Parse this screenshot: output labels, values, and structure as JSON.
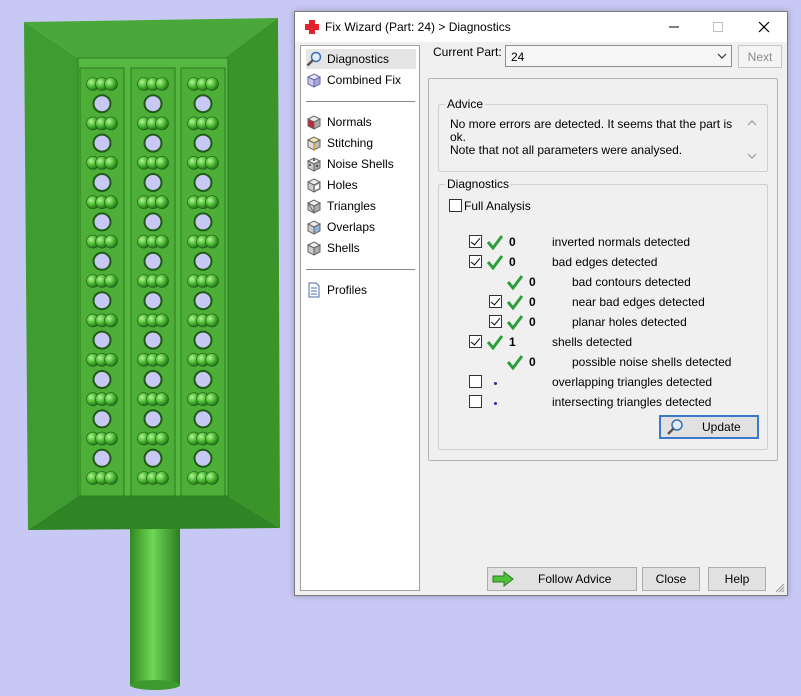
{
  "window": {
    "title": "Fix Wizard (Part: 24) > Diagnostics"
  },
  "nav": {
    "top_items": [
      {
        "label": "Diagnostics",
        "icon": "magnifier-icon",
        "selected": true
      },
      {
        "label": "Combined Fix",
        "icon": "combined-fix-cube-icon",
        "selected": false
      }
    ],
    "tool_items": [
      {
        "label": "Normals",
        "icon": "normals-cube-icon"
      },
      {
        "label": "Stitching",
        "icon": "stitching-cube-icon"
      },
      {
        "label": "Noise Shells",
        "icon": "noise-shells-cube-icon"
      },
      {
        "label": "Holes",
        "icon": "holes-cube-icon"
      },
      {
        "label": "Triangles",
        "icon": "triangles-cube-icon"
      },
      {
        "label": "Overlaps",
        "icon": "overlaps-cube-icon"
      },
      {
        "label": "Shells",
        "icon": "shells-cube-icon"
      }
    ],
    "bottom_items": [
      {
        "label": "Profiles",
        "icon": "document-icon"
      }
    ]
  },
  "part": {
    "label": "Current Part:",
    "value": "24",
    "next_label": "Next"
  },
  "advice": {
    "heading": "Advice",
    "text_line1": "No more errors are detected. It seems that the part is ok.",
    "text_line2": "Note that not all parameters were analysed."
  },
  "diagnostics": {
    "heading": "Diagnostics",
    "full_analysis_label": "Full Analysis",
    "full_analysis_checked": false,
    "rows": [
      {
        "checkbox": true,
        "checked": true,
        "status": "ok",
        "count": "0",
        "label": "inverted normals detected"
      },
      {
        "checkbox": true,
        "checked": true,
        "status": "ok",
        "count": "0",
        "label": "bad edges detected"
      },
      {
        "checkbox": false,
        "checked": false,
        "status": "ok",
        "count": "0",
        "label": "bad contours detected"
      },
      {
        "checkbox": true,
        "checked": true,
        "status": "ok",
        "count": "0",
        "label": "near bad edges detected"
      },
      {
        "checkbox": true,
        "checked": true,
        "status": "ok",
        "count": "0",
        "label": "planar holes detected"
      },
      {
        "checkbox": true,
        "checked": true,
        "status": "ok",
        "count": "1",
        "label": "shells detected"
      },
      {
        "checkbox": false,
        "checked": false,
        "status": "ok",
        "count": "0",
        "label": "possible noise shells detected"
      },
      {
        "checkbox": true,
        "checked": false,
        "status": "pending",
        "count": "",
        "label": "overlapping triangles detected"
      },
      {
        "checkbox": true,
        "checked": false,
        "status": "pending",
        "count": "",
        "label": "intersecting triangles detected"
      }
    ],
    "update_label": "Update"
  },
  "footer": {
    "follow_advice_label": "Follow Advice",
    "close_label": "Close",
    "help_label": "Help"
  },
  "colors": {
    "viewport_background": "#c8c8f4",
    "model_green": "#5fc24a",
    "tick_green": "#2e9e3c",
    "focus_blue": "#3a78c8"
  }
}
